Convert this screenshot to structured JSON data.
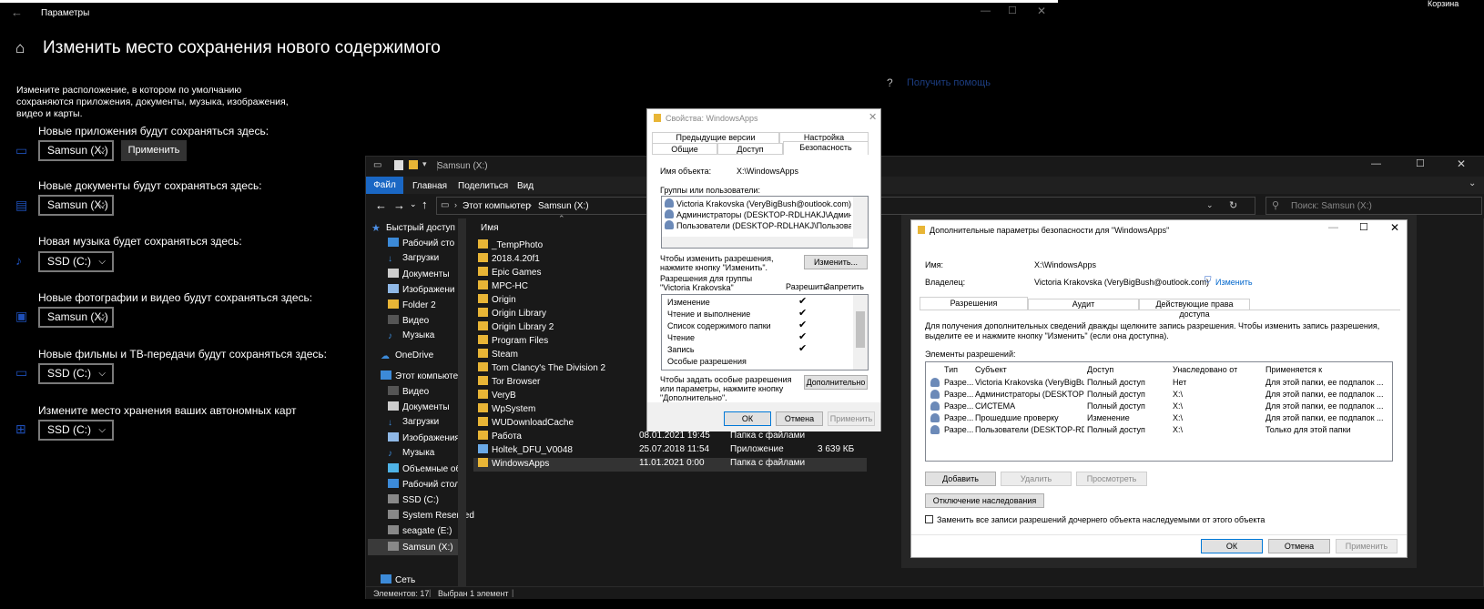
{
  "recycle_bin": {
    "label": "Корзина"
  },
  "settings": {
    "app_title": "Параметры",
    "page_title": "Изменить место сохранения нового содержимого",
    "description": "Измените расположение, в котором по умолчанию сохраняются приложения, документы, музыка, изображения, видео и карты.",
    "help_link": "Получить помощь",
    "apply_label": "Применить",
    "rows": [
      {
        "label": "Новые приложения будут сохраняться здесь:",
        "value": "Samsun (X:)"
      },
      {
        "label": "Новые документы будут сохраняться здесь:",
        "value": "Samsun (X:)"
      },
      {
        "label": "Новая музыка будет сохраняться здесь:",
        "value": "SSD (C:)"
      },
      {
        "label": "Новые фотографии и видео будут сохраняться здесь:",
        "value": "Samsun (X:)"
      },
      {
        "label": "Новые фильмы и ТВ-передачи будут сохраняться здесь:",
        "value": "SSD (C:)"
      },
      {
        "label": "Измените место хранения ваших автономных карт",
        "value": "SSD (C:)"
      }
    ]
  },
  "explorer": {
    "title": "Samsun (X:)",
    "ribbon_tabs": [
      "Файл",
      "Главная",
      "Поделиться",
      "Вид"
    ],
    "breadcrumb": [
      "Этот компьютер",
      "Samsun (X:)"
    ],
    "search_placeholder": "Поиск: Samsun (X:)",
    "nav": [
      "Быстрый доступ",
      "Рабочий сто",
      "Загрузки",
      "Документы",
      "Изображени",
      "Folder 2",
      "Видео",
      "Музыка",
      "OneDrive",
      "Этот компьютер",
      "Видео",
      "Документы",
      "Загрузки",
      "Изображения",
      "Музыка",
      "Объемные объ",
      "Рабочий стол",
      "SSD (C:)",
      "System Reserved",
      "seagate (E:)",
      "Samsun (X:)",
      "Сеть"
    ],
    "col_name": "Имя",
    "files": [
      {
        "name": "_TempPhoto",
        "date": "",
        "type": "",
        "size": ""
      },
      {
        "name": "2018.4.20f1",
        "date": "",
        "type": "",
        "size": ""
      },
      {
        "name": "Epic Games",
        "date": "",
        "type": "",
        "size": ""
      },
      {
        "name": "MPC-HC",
        "date": "",
        "type": "",
        "size": ""
      },
      {
        "name": "Origin",
        "date": "",
        "type": "",
        "size": ""
      },
      {
        "name": "Origin Library",
        "date": "",
        "type": "",
        "size": ""
      },
      {
        "name": "Origin Library 2",
        "date": "",
        "type": "",
        "size": ""
      },
      {
        "name": "Program Files",
        "date": "",
        "type": "",
        "size": ""
      },
      {
        "name": "Steam",
        "date": "",
        "type": "",
        "size": ""
      },
      {
        "name": "Tom Clancy's The Division 2",
        "date": "",
        "type": "",
        "size": ""
      },
      {
        "name": "Tor Browser",
        "date": "",
        "type": "",
        "size": ""
      },
      {
        "name": "VeryB",
        "date": "",
        "type": "",
        "size": ""
      },
      {
        "name": "WpSystem",
        "date": "",
        "type": "",
        "size": ""
      },
      {
        "name": "WUDownloadCache",
        "date": "",
        "type": "",
        "size": ""
      },
      {
        "name": "Работа",
        "date": "08.01.2021 19:45",
        "type": "Папка с файлами",
        "size": ""
      },
      {
        "name": "Holtek_DFU_V0048",
        "date": "25.07.2018 11:54",
        "type": "Приложение",
        "size": "3 639 КБ"
      },
      {
        "name": "WindowsApps",
        "date": "11.01.2021 0:00",
        "type": "Папка с файлами",
        "size": ""
      }
    ],
    "status": {
      "count": "Элементов: 17",
      "selected": "Выбран 1 элемент"
    }
  },
  "props": {
    "title": "Свойства: WindowsApps",
    "tabs_top": [
      "Предыдущие версии",
      "Настройка"
    ],
    "tabs_bottom": [
      "Общие",
      "Доступ",
      "Безопасность"
    ],
    "object_label": "Имя объекта:",
    "object_value": "X:\\WindowsApps",
    "groups_label": "Группы или пользователи:",
    "users": [
      "Victoria Krakovska (VeryBigBush@outlook.com)",
      "Администраторы (DESKTOP-RDLHAKJ\\Администратор",
      "Пользователи (DESKTOP-RDLHAKJ\\Пользователи)"
    ],
    "change_hint": "Чтобы изменить разрешения, нажмите кнопку \"Изменить\".",
    "change_btn": "Изменить...",
    "perm_label": "Разрешения для группы \"Victoria Krakovska\"",
    "allow": "Разрешить",
    "deny": "Запретить",
    "perms": [
      "Изменение",
      "Чтение и выполнение",
      "Список содержимого папки",
      "Чтение",
      "Запись",
      "Особые разрешения"
    ],
    "special_hint": "Чтобы задать особые разрешения или параметры, нажмите кнопку \"Дополнительно\".",
    "advanced_btn": "Дополнительно",
    "ok": "ОК",
    "cancel": "Отмена",
    "apply": "Применить"
  },
  "adv": {
    "title": "Дополнительные параметры безопасности  для \"WindowsApps\"",
    "name_label": "Имя:",
    "name_value": "X:\\WindowsApps",
    "owner_label": "Владелец:",
    "owner_value": "Victoria Krakovska (VeryBigBush@outlook.com)",
    "owner_change": "Изменить",
    "tabs": [
      "Разрешения",
      "Аудит",
      "Действующие права доступа"
    ],
    "info": "Для получения дополнительных сведений дважды щелкните запись разрешения. Чтобы изменить запись разрешения, выделите ее и нажмите кнопку \"Изменить\" (если она доступна).",
    "entries_label": "Элементы разрешений:",
    "headers": [
      "Тип",
      "Субъект",
      "Доступ",
      "Унаследовано от",
      "Применяется к"
    ],
    "rows": [
      [
        "Разре...",
        "Victoria Krakovska (VeryBigBu...",
        "Полный доступ",
        "Нет",
        "Для этой папки, ее подпапок ..."
      ],
      [
        "Разре...",
        "Администраторы (DESKTOP-...",
        "Полный доступ",
        "X:\\",
        "Для этой папки, ее подпапок ..."
      ],
      [
        "Разре...",
        "СИСТЕМА",
        "Полный доступ",
        "X:\\",
        "Для этой папки, ее подпапок ..."
      ],
      [
        "Разре...",
        "Прошедшие проверку",
        "Изменение",
        "X:\\",
        "Для этой папки, ее подпапок ..."
      ],
      [
        "Разре...",
        "Пользователи (DESKTOP-RD...",
        "Полный доступ",
        "X:\\",
        "Только для этой папки"
      ]
    ],
    "add": "Добавить",
    "remove": "Удалить",
    "view": "Просмотреть",
    "disable_inherit": "Отключение наследования",
    "replace_label": "Заменить все записи разрешений дочернего объекта наследуемыми от этого объекта",
    "ok": "ОК",
    "cancel": "Отмена",
    "apply": "Применить"
  }
}
